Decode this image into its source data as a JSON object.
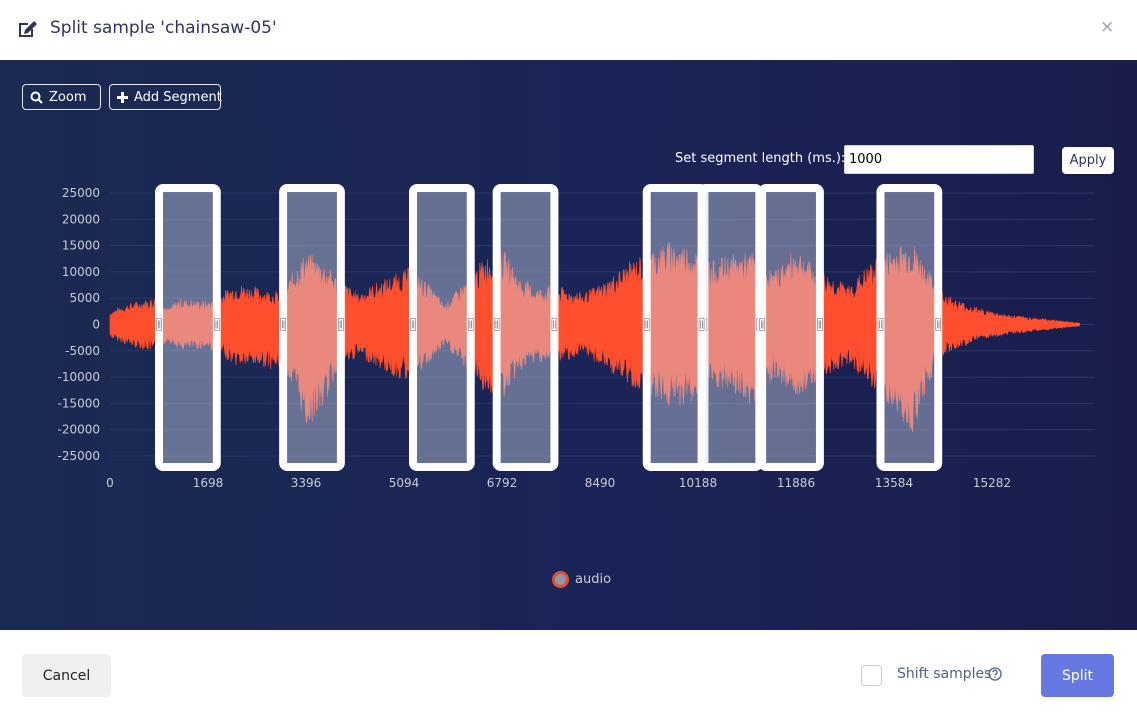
{
  "header": {
    "title": "Split sample 'chainsaw-05'",
    "edit_icon": "edit-icon",
    "close_label": "×"
  },
  "toolbar": {
    "zoom_label": "Zoom",
    "add_segment_label": "Add Segment",
    "segment_length_label": "Set segment length (ms.):",
    "segment_length_value": "1000",
    "apply_label": "Apply"
  },
  "chart_data": {
    "type": "area",
    "series": [
      {
        "name": "audio",
        "color": "#ff4f2e"
      }
    ],
    "x_ticks": [
      "0",
      "1698",
      "3396",
      "5094",
      "6792",
      "8490",
      "10188",
      "11886",
      "13584",
      "15282"
    ],
    "y_ticks": [
      "25000",
      "20000",
      "15000",
      "10000",
      "5000",
      "0",
      "-5000",
      "-10000",
      "-15000",
      "-20000",
      "-25000"
    ],
    "ylim": [
      -25000,
      25000
    ],
    "x_step": 1698,
    "envelope_ms": [
      0,
      300,
      850,
      1000,
      1200,
      1700,
      2200,
      2600,
      3000,
      3200,
      3400,
      3700,
      3950,
      4300,
      4600,
      4900,
      5200,
      5500,
      5800,
      6200,
      6500,
      6800,
      7100,
      7400,
      7700,
      8200,
      8600,
      9000,
      9300,
      9700,
      10100,
      10400,
      10800,
      11200,
      11500,
      11900,
      12200,
      12800,
      13200,
      13600,
      13900,
      14300,
      14600,
      15100,
      15600,
      16300,
      16800
    ],
    "envelope_upper": [
      2500,
      4000,
      5500,
      3000,
      5000,
      4500,
      8000,
      7000,
      6000,
      11000,
      14000,
      12000,
      9000,
      6000,
      8000,
      9500,
      11000,
      8000,
      4000,
      9000,
      13000,
      14500,
      9000,
      7000,
      7500,
      6000,
      8500,
      12000,
      14000,
      16000,
      15000,
      12000,
      13500,
      14000,
      10000,
      15000,
      11000,
      7500,
      12000,
      15000,
      16000,
      8000,
      5000,
      3000,
      1800,
      1000,
      300
    ],
    "envelope_lower": [
      -2500,
      -4000,
      -5500,
      -3000,
      -5000,
      -4500,
      -8000,
      -8000,
      -9000,
      -13000,
      -20000,
      -16000,
      -9000,
      -6000,
      -8000,
      -10000,
      -11000,
      -8000,
      -4000,
      -9000,
      -13000,
      -14500,
      -9000,
      -7000,
      -7500,
      -6000,
      -8500,
      -12000,
      -13000,
      -16000,
      -15000,
      -12000,
      -13500,
      -16000,
      -10000,
      -14000,
      -11000,
      -7500,
      -12000,
      -17000,
      -21000,
      -8000,
      -5000,
      -3000,
      -1800,
      -1000,
      -300
    ],
    "segments_ms": [
      [
        850,
        1850
      ],
      [
        3000,
        4000
      ],
      [
        5250,
        6250
      ],
      [
        6700,
        7700
      ],
      [
        9300,
        10300
      ],
      [
        10250,
        11250
      ],
      [
        11300,
        12300
      ],
      [
        13350,
        14350
      ]
    ],
    "legend": "audio"
  },
  "footer": {
    "cancel_label": "Cancel",
    "shift_label": "Shift samples",
    "shift_checked": false,
    "split_label": "Split"
  }
}
